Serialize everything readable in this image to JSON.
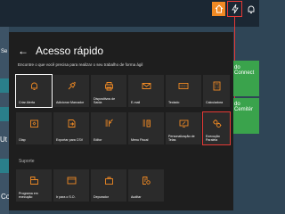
{
  "background": {
    "side_labels": {
      "connect": "do Connect",
      "cemit": "do Cemitér",
      "se": "Se",
      "ut": "Ut",
      "co": "Co"
    }
  },
  "panel": {
    "title": "Acesso rápido",
    "subtitle": "Encontre o que você precisa para realizar o seu trabalho de forma ágil",
    "tiles": [
      {
        "label": "Criar Alerta",
        "icon": "bell-icon"
      },
      {
        "label": "Adicionar Marcador",
        "icon": "pin-star-icon"
      },
      {
        "label": "Dispositivos de Saída",
        "icon": "printer-icon"
      },
      {
        "label": "E-mail",
        "icon": "mail-icon"
      },
      {
        "label": "Teclado",
        "icon": "keyboard-icon"
      },
      {
        "label": "Calculadora",
        "icon": "calculator-icon"
      },
      {
        "label": "Olap",
        "icon": "cube-icon"
      },
      {
        "label": "Exportar para CSV",
        "icon": "export-icon"
      },
      {
        "label": "Editor",
        "icon": "editor-icon"
      },
      {
        "label": "Menu Fiscal",
        "icon": "fiscal-menu-icon"
      },
      {
        "label": "Personalização de Telas",
        "icon": "screen-edit-icon"
      },
      {
        "label": "Execução Paralela",
        "icon": "parallel-gears-icon"
      }
    ],
    "support_heading": "Suporte",
    "support_tiles": [
      {
        "label": "Programa em execução",
        "icon": "program-icon"
      },
      {
        "label": "Ir para o S.O.",
        "icon": "terminal-icon"
      },
      {
        "label": "Depurador",
        "icon": "briefcase-icon"
      },
      {
        "label": "Auditar",
        "icon": "audit-icon"
      }
    ]
  },
  "colors": {
    "tile_bg": "#2b2b2b",
    "panel_bg": "#1e1e1e",
    "accent_orange": "#f08a24",
    "highlight_red": "#e53935",
    "app_green": "#3aa34c"
  }
}
